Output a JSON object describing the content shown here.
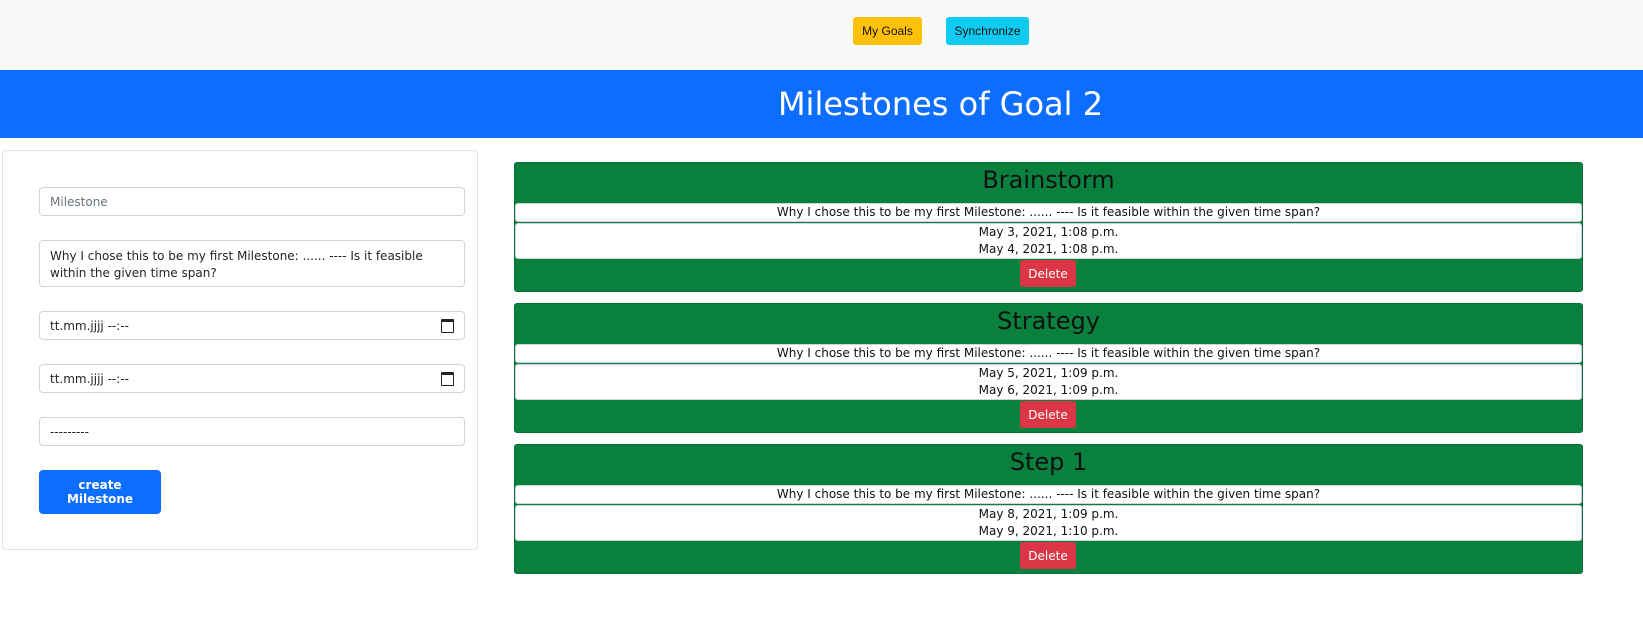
{
  "nav": {
    "my_goals": "My Goals",
    "synchronize": "Synchronize"
  },
  "colors": {
    "nav_bg": "#f8f9fa",
    "banner": "#0d6efd",
    "goals_btn": "#ffc107",
    "sync_btn": "#0dcaf0",
    "card_bg": "#0a803f",
    "delete_btn": "#dc3545",
    "create_btn": "#0d6efd"
  },
  "page_title": "Milestones of Goal 2",
  "form": {
    "milestone_placeholder": "Milestone",
    "description_value": "Why I chose this to be my first Milestone: ...... ---- Is it feasible within the given time span?",
    "start_date": "tt.mm.jjjj --:--",
    "end_date": "tt.mm.jjjj --:--",
    "select_value": "---------",
    "calendar_icon": "calendar-icon",
    "create_label": "create Milestone"
  },
  "milestones": [
    {
      "title": "Brainstorm",
      "description": "Why I chose this to be my first Milestone: ...... ---- Is it feasible within the given time span?",
      "start": "May 3, 2021, 1:08 p.m.",
      "end": "May 4, 2021, 1:08 p.m.",
      "delete_label": "Delete"
    },
    {
      "title": "Strategy",
      "description": "Why I chose this to be my first Milestone: ...... ---- Is it feasible within the given time span?",
      "start": "May 5, 2021, 1:09 p.m.",
      "end": "May 6, 2021, 1:09 p.m.",
      "delete_label": "Delete"
    },
    {
      "title": "Step 1",
      "description": "Why I chose this to be my first Milestone: ...... ---- Is it feasible within the given time span?",
      "start": "May 8, 2021, 1:09 p.m.",
      "end": "May 9, 2021, 1:10 p.m.",
      "delete_label": "Delete"
    }
  ]
}
